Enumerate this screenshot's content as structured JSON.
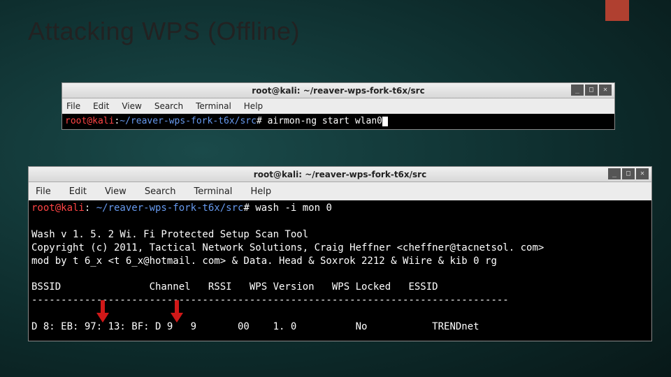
{
  "slide": {
    "title": "Attacking WPS (Offline)"
  },
  "window_title": "root@kali: ~/reaver-wps-fork-t6x/src",
  "win_controls": {
    "min": "_",
    "max": "□",
    "close": "✕"
  },
  "menu": {
    "file": "File",
    "edit": "Edit",
    "view": "View",
    "search": "Search",
    "terminal": "Terminal",
    "help": "Help"
  },
  "term1": {
    "prompt_user": "root@kali",
    "colon": ":",
    "path": "~/reaver-wps-fork-t6x/src",
    "hash": "#",
    "cmd": " airmon-ng start wlan0"
  },
  "term2": {
    "prompt_user": "root@kali",
    "colon": ": ",
    "path": "~/reaver-wps-fork-t6x/src",
    "hash": "#",
    "cmd": " wash -i mon 0",
    "blank": "",
    "out1": "Wash v 1. 5. 2 Wi. Fi Protected Setup Scan Tool",
    "out2": "Copyright (c) 2011, Tactical Network Solutions, Craig Heffner <cheffner@tacnetsol. com>",
    "out3": "mod by t 6_x <t 6_x@hotmail. com> & Data. Head & Soxrok 2212 & Wiire & kib 0 rg",
    "header": "BSSID               Channel   RSSI   WPS Version   WPS Locked   ESSID",
    "sep": "---------------------------------------------------------------------------------",
    "row1": "D 8: EB: 97: 13: BF: D 9   9       00    1. 0          No           TRENDnet"
  }
}
